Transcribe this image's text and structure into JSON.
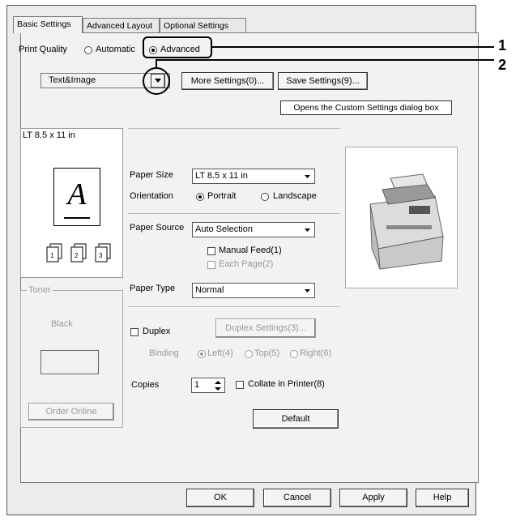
{
  "tabs": [
    "Basic Settings",
    "Advanced Layout",
    "Optional Settings"
  ],
  "print_quality": {
    "label": "Print Quality",
    "automatic": "Automatic",
    "advanced": "Advanced",
    "selected": "Advanced"
  },
  "quality_select": "Text&Image",
  "buttons": {
    "more_settings": "More Settings(0)...",
    "save_settings": "Save Settings(9)...",
    "duplex_settings": "Duplex Settings(3)...",
    "default": "Default",
    "order_online": "Order Online",
    "ok": "OK",
    "cancel": "Cancel",
    "apply": "Apply",
    "help": "Help"
  },
  "tooltip": "Opens the Custom Settings dialog box",
  "preview": {
    "paper_label": "LT 8.5 x 11 in",
    "letter": "A"
  },
  "toner": {
    "group_label": "Toner",
    "black_label": "Black"
  },
  "paper_size": {
    "label": "Paper Size",
    "value": "LT 8.5 x 11 in"
  },
  "orientation": {
    "label": "Orientation",
    "portrait": "Portrait",
    "landscape": "Landscape",
    "selected": "Portrait"
  },
  "paper_source": {
    "label": "Paper Source",
    "value": "Auto Selection"
  },
  "manual_feed": "Manual Feed(1)",
  "each_page": "Each Page(2)",
  "paper_type": {
    "label": "Paper Type",
    "value": "Normal"
  },
  "duplex": "Duplex",
  "binding": {
    "label": "Binding",
    "left": "Left(4)",
    "top": "Top(5)",
    "right": "Right(6)"
  },
  "copies": {
    "label": "Copies",
    "value": "1"
  },
  "collate": "Collate in Printer(8)",
  "callouts": [
    "1",
    "2"
  ]
}
